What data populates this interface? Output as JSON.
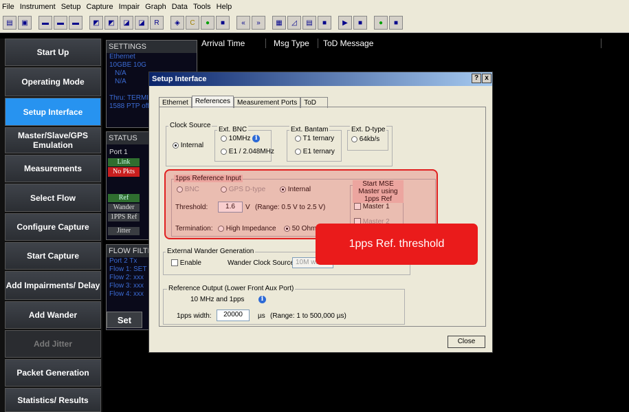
{
  "menu": [
    "File",
    "Instrument",
    "Setup",
    "Capture",
    "Impair",
    "Graph",
    "Data",
    "Tools",
    "Help"
  ],
  "toolbar_icons": [
    "open-icon",
    "save-icon",
    "port-icon",
    "port-icon",
    "port-icon",
    "config-icon",
    "config-icon",
    "config-icon",
    "config-icon",
    "config-icon",
    "config-icon",
    "color-icon",
    "color-icon",
    "power-icon",
    "stop-icon",
    "rewind-icon",
    "forward-icon",
    "grid-icon",
    "chart-icon",
    "table-icon",
    "table-icon",
    "play-icon",
    "stop-icon",
    "ping-icon",
    "pause-icon"
  ],
  "toolbar_labels": {
    "r": "R",
    "c": "C"
  },
  "nav": [
    {
      "label": "Start Up"
    },
    {
      "label": "Operating Mode"
    },
    {
      "label": "Setup Interface"
    },
    {
      "label": "Master/Slave/GPS Emulation"
    },
    {
      "label": "Measurements"
    },
    {
      "label": "Select Flow"
    },
    {
      "label": "Configure Capture"
    },
    {
      "label": "Start Capture"
    },
    {
      "label": "Add Impairments/ Delay"
    },
    {
      "label": "Add Wander"
    },
    {
      "label": "Add Jitter"
    },
    {
      "label": "Packet Generation"
    },
    {
      "label": "Statistics/ Results"
    }
  ],
  "settings": {
    "title": "SETTINGS",
    "lines": [
      "Ethernet",
      "10GBE  10G",
      "N/A",
      "N/A",
      "",
      "Thru: TERMIN",
      "1588 PTP off"
    ]
  },
  "status": {
    "title": "STATUS",
    "port": "Port 1",
    "link": "Link",
    "nopkts": "No Pkts",
    "ref": "Ref",
    "wander": "Wander",
    "pps": "1PPS Ref",
    "jitter": "Jitter"
  },
  "flow": {
    "title": "FLOW FILTER",
    "lines": [
      "Port 2 Tx",
      "Flow 1: SET",
      "Flow 2: xxx",
      "Flow 3: xxx",
      "Flow 4: xxx"
    ],
    "set": "Set"
  },
  "table": {
    "cols": [
      "Arrival Time",
      "Msg Type",
      "ToD Message"
    ]
  },
  "dialog": {
    "title": "Setup Interface",
    "help": "?",
    "close_x": "x",
    "tabs": [
      "Ethernet",
      "References",
      "Measurement Ports",
      "ToD"
    ],
    "clock_source": {
      "label": "Clock Source",
      "internal": "Internal",
      "ext_bnc": "Ext. BNC",
      "bnc10": "10MHz",
      "e1": "E1 / 2.048MHz",
      "ext_bantam": "Ext. Bantam",
      "t1": "T1 ternary",
      "e1t": "E1 ternary",
      "ext_d": "Ext. D-type",
      "k64": "64kb/s"
    },
    "pps": {
      "label": "1pps Reference Input",
      "bnc": "BNC",
      "gps": "GPS D-type",
      "internal": "Internal",
      "threshold_label": "Threshold:",
      "threshold": "1.6",
      "unit": "V",
      "range": "(Range: 0.5 V to 2.5 V)",
      "termination": "Termination:",
      "high": "High Impedance",
      "ohm": "50 Ohm",
      "mse": "Start MSE Master using 1pps Ref",
      "master1": "Master 1",
      "master2": "Master 2"
    },
    "wander": {
      "label": "External Wander Generation",
      "enable": "Enable",
      "clock_src": "Wander Clock Source:",
      "clock_val": "10M wa"
    },
    "refout": {
      "label": "Reference Output (Lower Front Aux Port)",
      "freq": "10 MHz and 1pps",
      "width_label": "1pps width:",
      "width": "20000",
      "unit": "µs",
      "range": "(Range: 1 to 500,000 µs)"
    },
    "close": "Close"
  },
  "callout": "1pps Ref. threshold"
}
